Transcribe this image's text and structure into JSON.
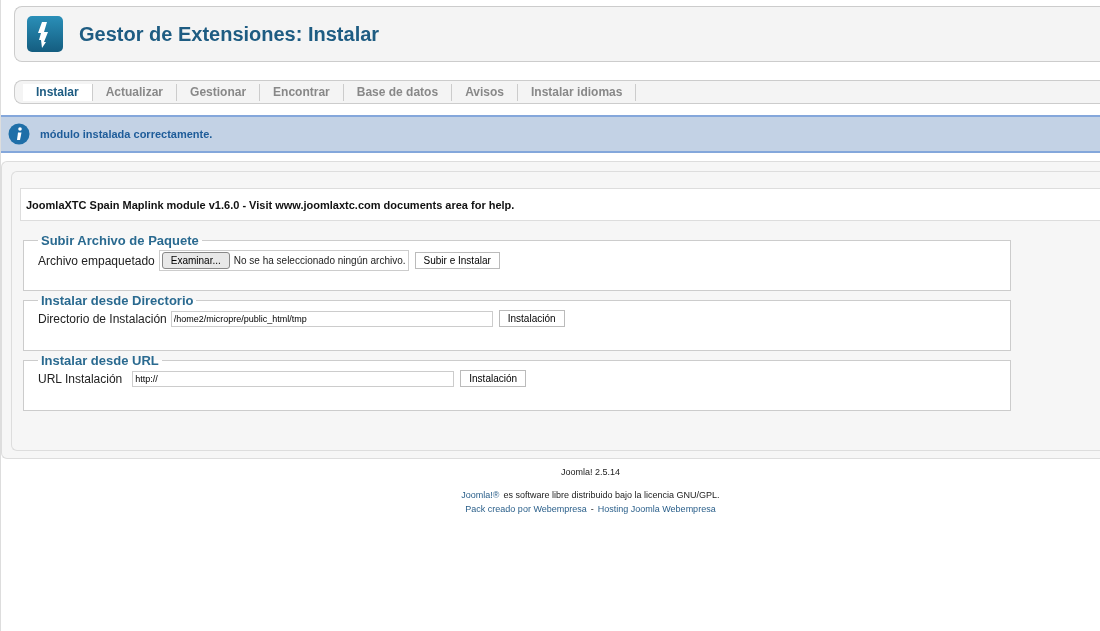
{
  "header": {
    "title": "Gestor de Extensiones: Instalar"
  },
  "tabs": [
    {
      "label": "Instalar",
      "selected": true
    },
    {
      "label": "Actualizar",
      "selected": false
    },
    {
      "label": "Gestionar",
      "selected": false
    },
    {
      "label": "Encontrar",
      "selected": false
    },
    {
      "label": "Base de datos",
      "selected": false
    },
    {
      "label": "Avisos",
      "selected": false
    },
    {
      "label": "Instalar idiomas",
      "selected": false
    }
  ],
  "message": "módulo instalada correctamente.",
  "description": "JoomlaXTC Spain Maplink module v1.6.0 - Visit www.joomlaxtc.com documents area for help.",
  "upload": {
    "legend": "Subir Archivo de Paquete",
    "label": "Archivo empaquetado",
    "browse": "Examinar...",
    "file_status": "No se ha seleccionado ningún archivo.",
    "button": "Subir e Instalar"
  },
  "directory": {
    "legend": "Instalar desde Directorio",
    "label": "Directorio de Instalación",
    "value": "/home2/micropre/public_html/tmp",
    "button": "Instalación"
  },
  "url": {
    "legend": "Instalar desde URL",
    "label": "URL Instalación",
    "value": "http://",
    "button": "Instalación"
  },
  "footer": {
    "version": "Joomla! 2.5.14",
    "license_link": "Joomla!®",
    "license_text": "es software libre distribuido bajo la licencia GNU/GPL.",
    "pack_link": "Pack creado por Webempresa",
    "separator": "-",
    "hosting_link": "Hosting Joomla Webempresa"
  }
}
